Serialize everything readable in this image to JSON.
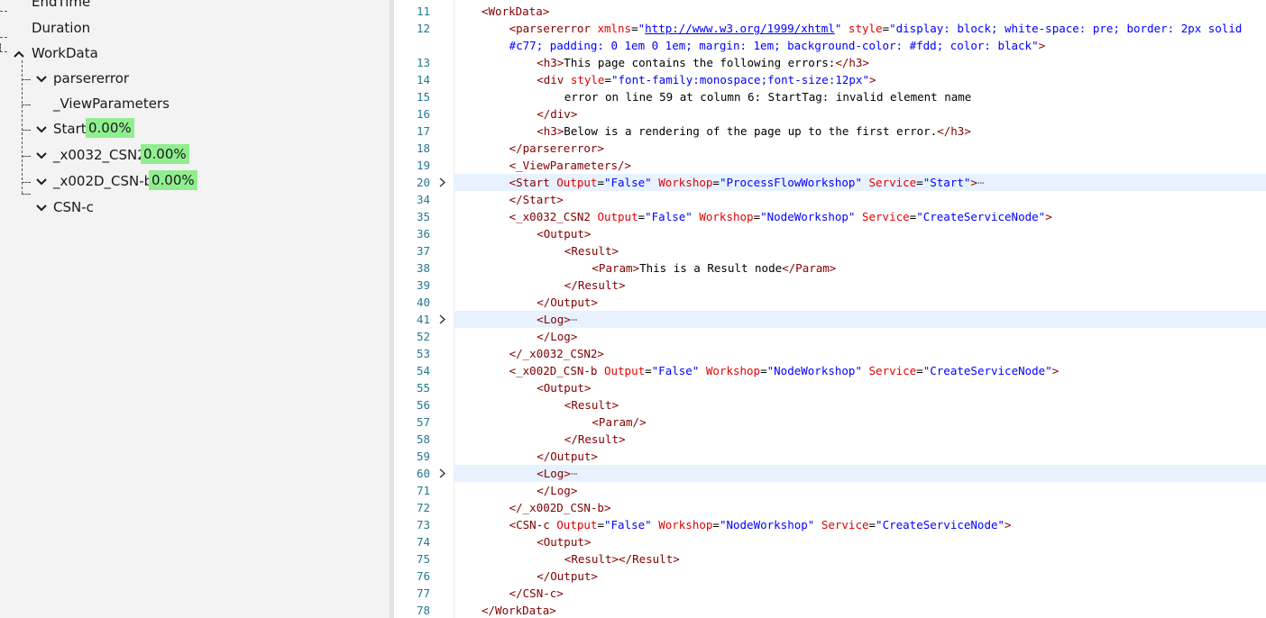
{
  "tree": {
    "items": [
      {
        "label": "EndTime",
        "chevron": "none",
        "badge": ""
      },
      {
        "label": "Duration",
        "chevron": "none",
        "badge": ""
      },
      {
        "label": "WorkData",
        "chevron": "up",
        "badge": ""
      },
      {
        "label": "parsererror",
        "chevron": "down",
        "badge": ""
      },
      {
        "label": "_ViewParameters",
        "chevron": "none",
        "badge": ""
      },
      {
        "label": "Start",
        "chevron": "down",
        "badge": "0.00%"
      },
      {
        "label": "_x0032_CSN2",
        "chevron": "down",
        "badge": "0.00%"
      },
      {
        "label": "_x002D_CSN-b",
        "chevron": "down",
        "badge": "0.00%"
      },
      {
        "label": "CSN-c",
        "chevron": "down",
        "badge": ""
      }
    ],
    "colors": {
      "badge": "#90ee90"
    }
  },
  "editor": {
    "colors": {
      "tag": "#800000",
      "attr": "#e50000",
      "value": "#0000ff",
      "linenum": "#237893",
      "highlight": "#e8f2ff"
    },
    "lines": [
      {
        "n": "11",
        "fold": false,
        "hl": false,
        "indent": 1,
        "segs": [
          [
            "t",
            "<WorkData>"
          ]
        ]
      },
      {
        "n": "12",
        "fold": false,
        "hl": false,
        "indent": 2,
        "segs": [
          [
            "t",
            "<parsererror"
          ],
          [
            "x",
            " "
          ],
          [
            "a",
            "xmlns"
          ],
          [
            "x",
            "="
          ],
          [
            "v",
            "\""
          ],
          [
            "u",
            "http://www.w3.org/1999/xhtml"
          ],
          [
            "v",
            "\""
          ],
          [
            "x",
            " "
          ],
          [
            "a",
            "style"
          ],
          [
            "x",
            "="
          ],
          [
            "v",
            "\"display: block; white-space: pre; border: 2px solid"
          ]
        ]
      },
      {
        "n": "",
        "fold": false,
        "hl": false,
        "indent": 2,
        "segs": [
          [
            "v",
            "#c77; padding: 0 1em 0 1em; margin: 1em; background-color: #fdd; color: black\""
          ],
          [
            "t",
            ">"
          ]
        ]
      },
      {
        "n": "13",
        "fold": false,
        "hl": false,
        "indent": 3,
        "segs": [
          [
            "t",
            "<h3>"
          ],
          [
            "x",
            "This page contains the following errors:"
          ],
          [
            "t",
            "</h3>"
          ]
        ]
      },
      {
        "n": "14",
        "fold": false,
        "hl": false,
        "indent": 3,
        "segs": [
          [
            "t",
            "<div"
          ],
          [
            "x",
            " "
          ],
          [
            "a",
            "style"
          ],
          [
            "x",
            "="
          ],
          [
            "v",
            "\"font-family:monospace;font-size:12px\""
          ],
          [
            "t",
            ">"
          ]
        ]
      },
      {
        "n": "15",
        "fold": false,
        "hl": false,
        "indent": 4,
        "segs": [
          [
            "x",
            "error on line 59 at column 6: StartTag: invalid element name"
          ]
        ]
      },
      {
        "n": "16",
        "fold": false,
        "hl": false,
        "indent": 3,
        "segs": [
          [
            "t",
            "</div>"
          ]
        ]
      },
      {
        "n": "17",
        "fold": false,
        "hl": false,
        "indent": 3,
        "segs": [
          [
            "t",
            "<h3>"
          ],
          [
            "x",
            "Below is a rendering of the page up to the first error."
          ],
          [
            "t",
            "</h3>"
          ]
        ]
      },
      {
        "n": "18",
        "fold": false,
        "hl": false,
        "indent": 2,
        "segs": [
          [
            "t",
            "</parsererror>"
          ]
        ]
      },
      {
        "n": "19",
        "fold": false,
        "hl": false,
        "indent": 2,
        "segs": [
          [
            "t",
            "<_ViewParameters/>"
          ]
        ]
      },
      {
        "n": "20",
        "fold": true,
        "hl": true,
        "indent": 2,
        "segs": [
          [
            "t",
            "<Start"
          ],
          [
            "x",
            " "
          ],
          [
            "a",
            "Output"
          ],
          [
            "x",
            "="
          ],
          [
            "v",
            "\"False\""
          ],
          [
            "x",
            " "
          ],
          [
            "a",
            "Workshop"
          ],
          [
            "x",
            "="
          ],
          [
            "v",
            "\"ProcessFlowWorkshop\""
          ],
          [
            "x",
            " "
          ],
          [
            "a",
            "Service"
          ],
          [
            "x",
            "="
          ],
          [
            "v",
            "\"Start\""
          ],
          [
            "t",
            ">"
          ],
          [
            "e",
            "⋯"
          ]
        ]
      },
      {
        "n": "34",
        "fold": false,
        "hl": false,
        "indent": 2,
        "segs": [
          [
            "t",
            "</Start>"
          ]
        ]
      },
      {
        "n": "35",
        "fold": false,
        "hl": false,
        "indent": 2,
        "segs": [
          [
            "t",
            "<_x0032_CSN2"
          ],
          [
            "x",
            " "
          ],
          [
            "a",
            "Output"
          ],
          [
            "x",
            "="
          ],
          [
            "v",
            "\"False\""
          ],
          [
            "x",
            " "
          ],
          [
            "a",
            "Workshop"
          ],
          [
            "x",
            "="
          ],
          [
            "v",
            "\"NodeWorkshop\""
          ],
          [
            "x",
            " "
          ],
          [
            "a",
            "Service"
          ],
          [
            "x",
            "="
          ],
          [
            "v",
            "\"CreateServiceNode\""
          ],
          [
            "t",
            ">"
          ]
        ]
      },
      {
        "n": "36",
        "fold": false,
        "hl": false,
        "indent": 3,
        "segs": [
          [
            "t",
            "<Output>"
          ]
        ]
      },
      {
        "n": "37",
        "fold": false,
        "hl": false,
        "indent": 4,
        "segs": [
          [
            "t",
            "<Result>"
          ]
        ]
      },
      {
        "n": "38",
        "fold": false,
        "hl": false,
        "indent": 5,
        "segs": [
          [
            "t",
            "<Param>"
          ],
          [
            "x",
            "This is a Result node"
          ],
          [
            "t",
            "</Param>"
          ]
        ]
      },
      {
        "n": "39",
        "fold": false,
        "hl": false,
        "indent": 4,
        "segs": [
          [
            "t",
            "</Result>"
          ]
        ]
      },
      {
        "n": "40",
        "fold": false,
        "hl": false,
        "indent": 3,
        "segs": [
          [
            "t",
            "</Output>"
          ]
        ]
      },
      {
        "n": "41",
        "fold": true,
        "hl": true,
        "indent": 3,
        "segs": [
          [
            "t",
            "<Log>"
          ],
          [
            "e",
            "⋯"
          ]
        ]
      },
      {
        "n": "52",
        "fold": false,
        "hl": false,
        "indent": 3,
        "segs": [
          [
            "t",
            "</Log>"
          ]
        ]
      },
      {
        "n": "53",
        "fold": false,
        "hl": false,
        "indent": 2,
        "segs": [
          [
            "t",
            "</_x0032_CSN2>"
          ]
        ]
      },
      {
        "n": "54",
        "fold": false,
        "hl": false,
        "indent": 2,
        "segs": [
          [
            "t",
            "<_x002D_CSN-b"
          ],
          [
            "x",
            " "
          ],
          [
            "a",
            "Output"
          ],
          [
            "x",
            "="
          ],
          [
            "v",
            "\"False\""
          ],
          [
            "x",
            " "
          ],
          [
            "a",
            "Workshop"
          ],
          [
            "x",
            "="
          ],
          [
            "v",
            "\"NodeWorkshop\""
          ],
          [
            "x",
            " "
          ],
          [
            "a",
            "Service"
          ],
          [
            "x",
            "="
          ],
          [
            "v",
            "\"CreateServiceNode\""
          ],
          [
            "t",
            ">"
          ]
        ]
      },
      {
        "n": "55",
        "fold": false,
        "hl": false,
        "indent": 3,
        "segs": [
          [
            "t",
            "<Output>"
          ]
        ]
      },
      {
        "n": "56",
        "fold": false,
        "hl": false,
        "indent": 4,
        "segs": [
          [
            "t",
            "<Result>"
          ]
        ]
      },
      {
        "n": "57",
        "fold": false,
        "hl": false,
        "indent": 5,
        "segs": [
          [
            "t",
            "<Param/>"
          ]
        ]
      },
      {
        "n": "58",
        "fold": false,
        "hl": false,
        "indent": 4,
        "segs": [
          [
            "t",
            "</Result>"
          ]
        ]
      },
      {
        "n": "59",
        "fold": false,
        "hl": false,
        "indent": 3,
        "segs": [
          [
            "t",
            "</Output>"
          ]
        ]
      },
      {
        "n": "60",
        "fold": true,
        "hl": true,
        "indent": 3,
        "segs": [
          [
            "t",
            "<Log>"
          ],
          [
            "e",
            "⋯"
          ]
        ]
      },
      {
        "n": "71",
        "fold": false,
        "hl": false,
        "indent": 3,
        "segs": [
          [
            "t",
            "</Log>"
          ]
        ]
      },
      {
        "n": "72",
        "fold": false,
        "hl": false,
        "indent": 2,
        "segs": [
          [
            "t",
            "</_x002D_CSN-b>"
          ]
        ]
      },
      {
        "n": "73",
        "fold": false,
        "hl": false,
        "indent": 2,
        "segs": [
          [
            "t",
            "<CSN-c"
          ],
          [
            "x",
            " "
          ],
          [
            "a",
            "Output"
          ],
          [
            "x",
            "="
          ],
          [
            "v",
            "\"False\""
          ],
          [
            "x",
            " "
          ],
          [
            "a",
            "Workshop"
          ],
          [
            "x",
            "="
          ],
          [
            "v",
            "\"NodeWorkshop\""
          ],
          [
            "x",
            " "
          ],
          [
            "a",
            "Service"
          ],
          [
            "x",
            "="
          ],
          [
            "v",
            "\"CreateServiceNode\""
          ],
          [
            "t",
            ">"
          ]
        ]
      },
      {
        "n": "74",
        "fold": false,
        "hl": false,
        "indent": 3,
        "segs": [
          [
            "t",
            "<Output>"
          ]
        ]
      },
      {
        "n": "75",
        "fold": false,
        "hl": false,
        "indent": 4,
        "segs": [
          [
            "t",
            "<Result>"
          ],
          [
            "t",
            "</Result>"
          ]
        ]
      },
      {
        "n": "76",
        "fold": false,
        "hl": false,
        "indent": 3,
        "segs": [
          [
            "t",
            "</Output>"
          ]
        ]
      },
      {
        "n": "77",
        "fold": false,
        "hl": false,
        "indent": 2,
        "segs": [
          [
            "t",
            "</CSN-c>"
          ]
        ]
      },
      {
        "n": "78",
        "fold": false,
        "hl": false,
        "indent": 1,
        "segs": [
          [
            "t",
            "</WorkData>"
          ]
        ]
      }
    ]
  }
}
